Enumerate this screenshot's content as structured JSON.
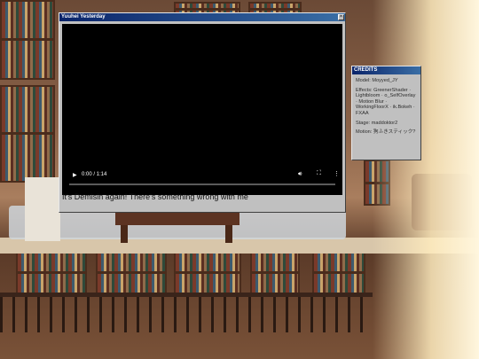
{
  "player": {
    "window_title": "Yuuhei Yesterday",
    "close_symbol": "×",
    "play_symbol": "▶",
    "time": "0:00 / 1:14",
    "progress": 0,
    "volume_icon": "volume-icon",
    "fullscreen_icon": "fullscreen-icon",
    "more_icon": "more-options-icon",
    "subtitle": "It's Demisin again! There's something wrong with me"
  },
  "credits": {
    "window_title": "CREDITS",
    "lines": [
      "Model: Moyyed_JY",
      "Effects: GreenerShader · Lightbloom · o_SelfOverlay · Motion Blur · WorkingFloorX · ik.Bokeh · FXAA",
      "Stage: maddoktor2",
      "Motion: 狗ふきスティック?"
    ]
  },
  "colors": {
    "titlebar_start": "#0a246a",
    "titlebar_end": "#3a6ea5",
    "window_face": "#c0c0c0",
    "video_bg": "#000000"
  }
}
